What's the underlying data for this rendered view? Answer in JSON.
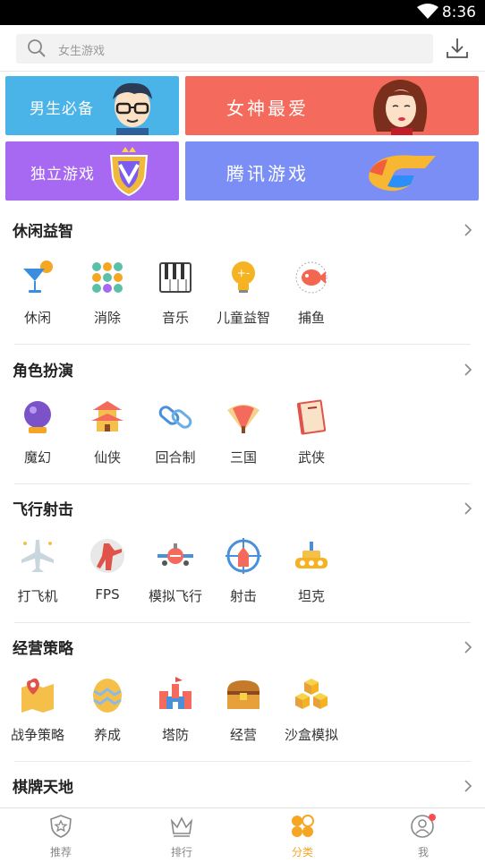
{
  "status_bar": {
    "time": "8:36"
  },
  "search": {
    "placeholder": "女生游戏"
  },
  "banners": {
    "boys": "男生必备",
    "goddess": "女神最爱",
    "indie": "独立游戏",
    "tencent": "腾讯游戏"
  },
  "sections": [
    {
      "title": "休闲益智",
      "items": [
        "休闲",
        "消除",
        "音乐",
        "儿童益智",
        "捕鱼"
      ]
    },
    {
      "title": "角色扮演",
      "items": [
        "魔幻",
        "仙侠",
        "回合制",
        "三国",
        "武侠"
      ]
    },
    {
      "title": "飞行射击",
      "items": [
        "打飞机",
        "FPS",
        "模拟飞行",
        "射击",
        "坦克"
      ]
    },
    {
      "title": "经营策略",
      "items": [
        "战争策略",
        "养成",
        "塔防",
        "经营",
        "沙盒模拟"
      ]
    },
    {
      "title": "棋牌天地",
      "items": []
    }
  ],
  "tabs": [
    {
      "label": "推荐",
      "icon": "shield-star-icon"
    },
    {
      "label": "排行",
      "icon": "crown-icon"
    },
    {
      "label": "分类",
      "icon": "category-icon"
    },
    {
      "label": "我",
      "icon": "user-icon"
    }
  ],
  "colors": {
    "accent": "#f5a623",
    "badge": "#ff4d4f"
  }
}
